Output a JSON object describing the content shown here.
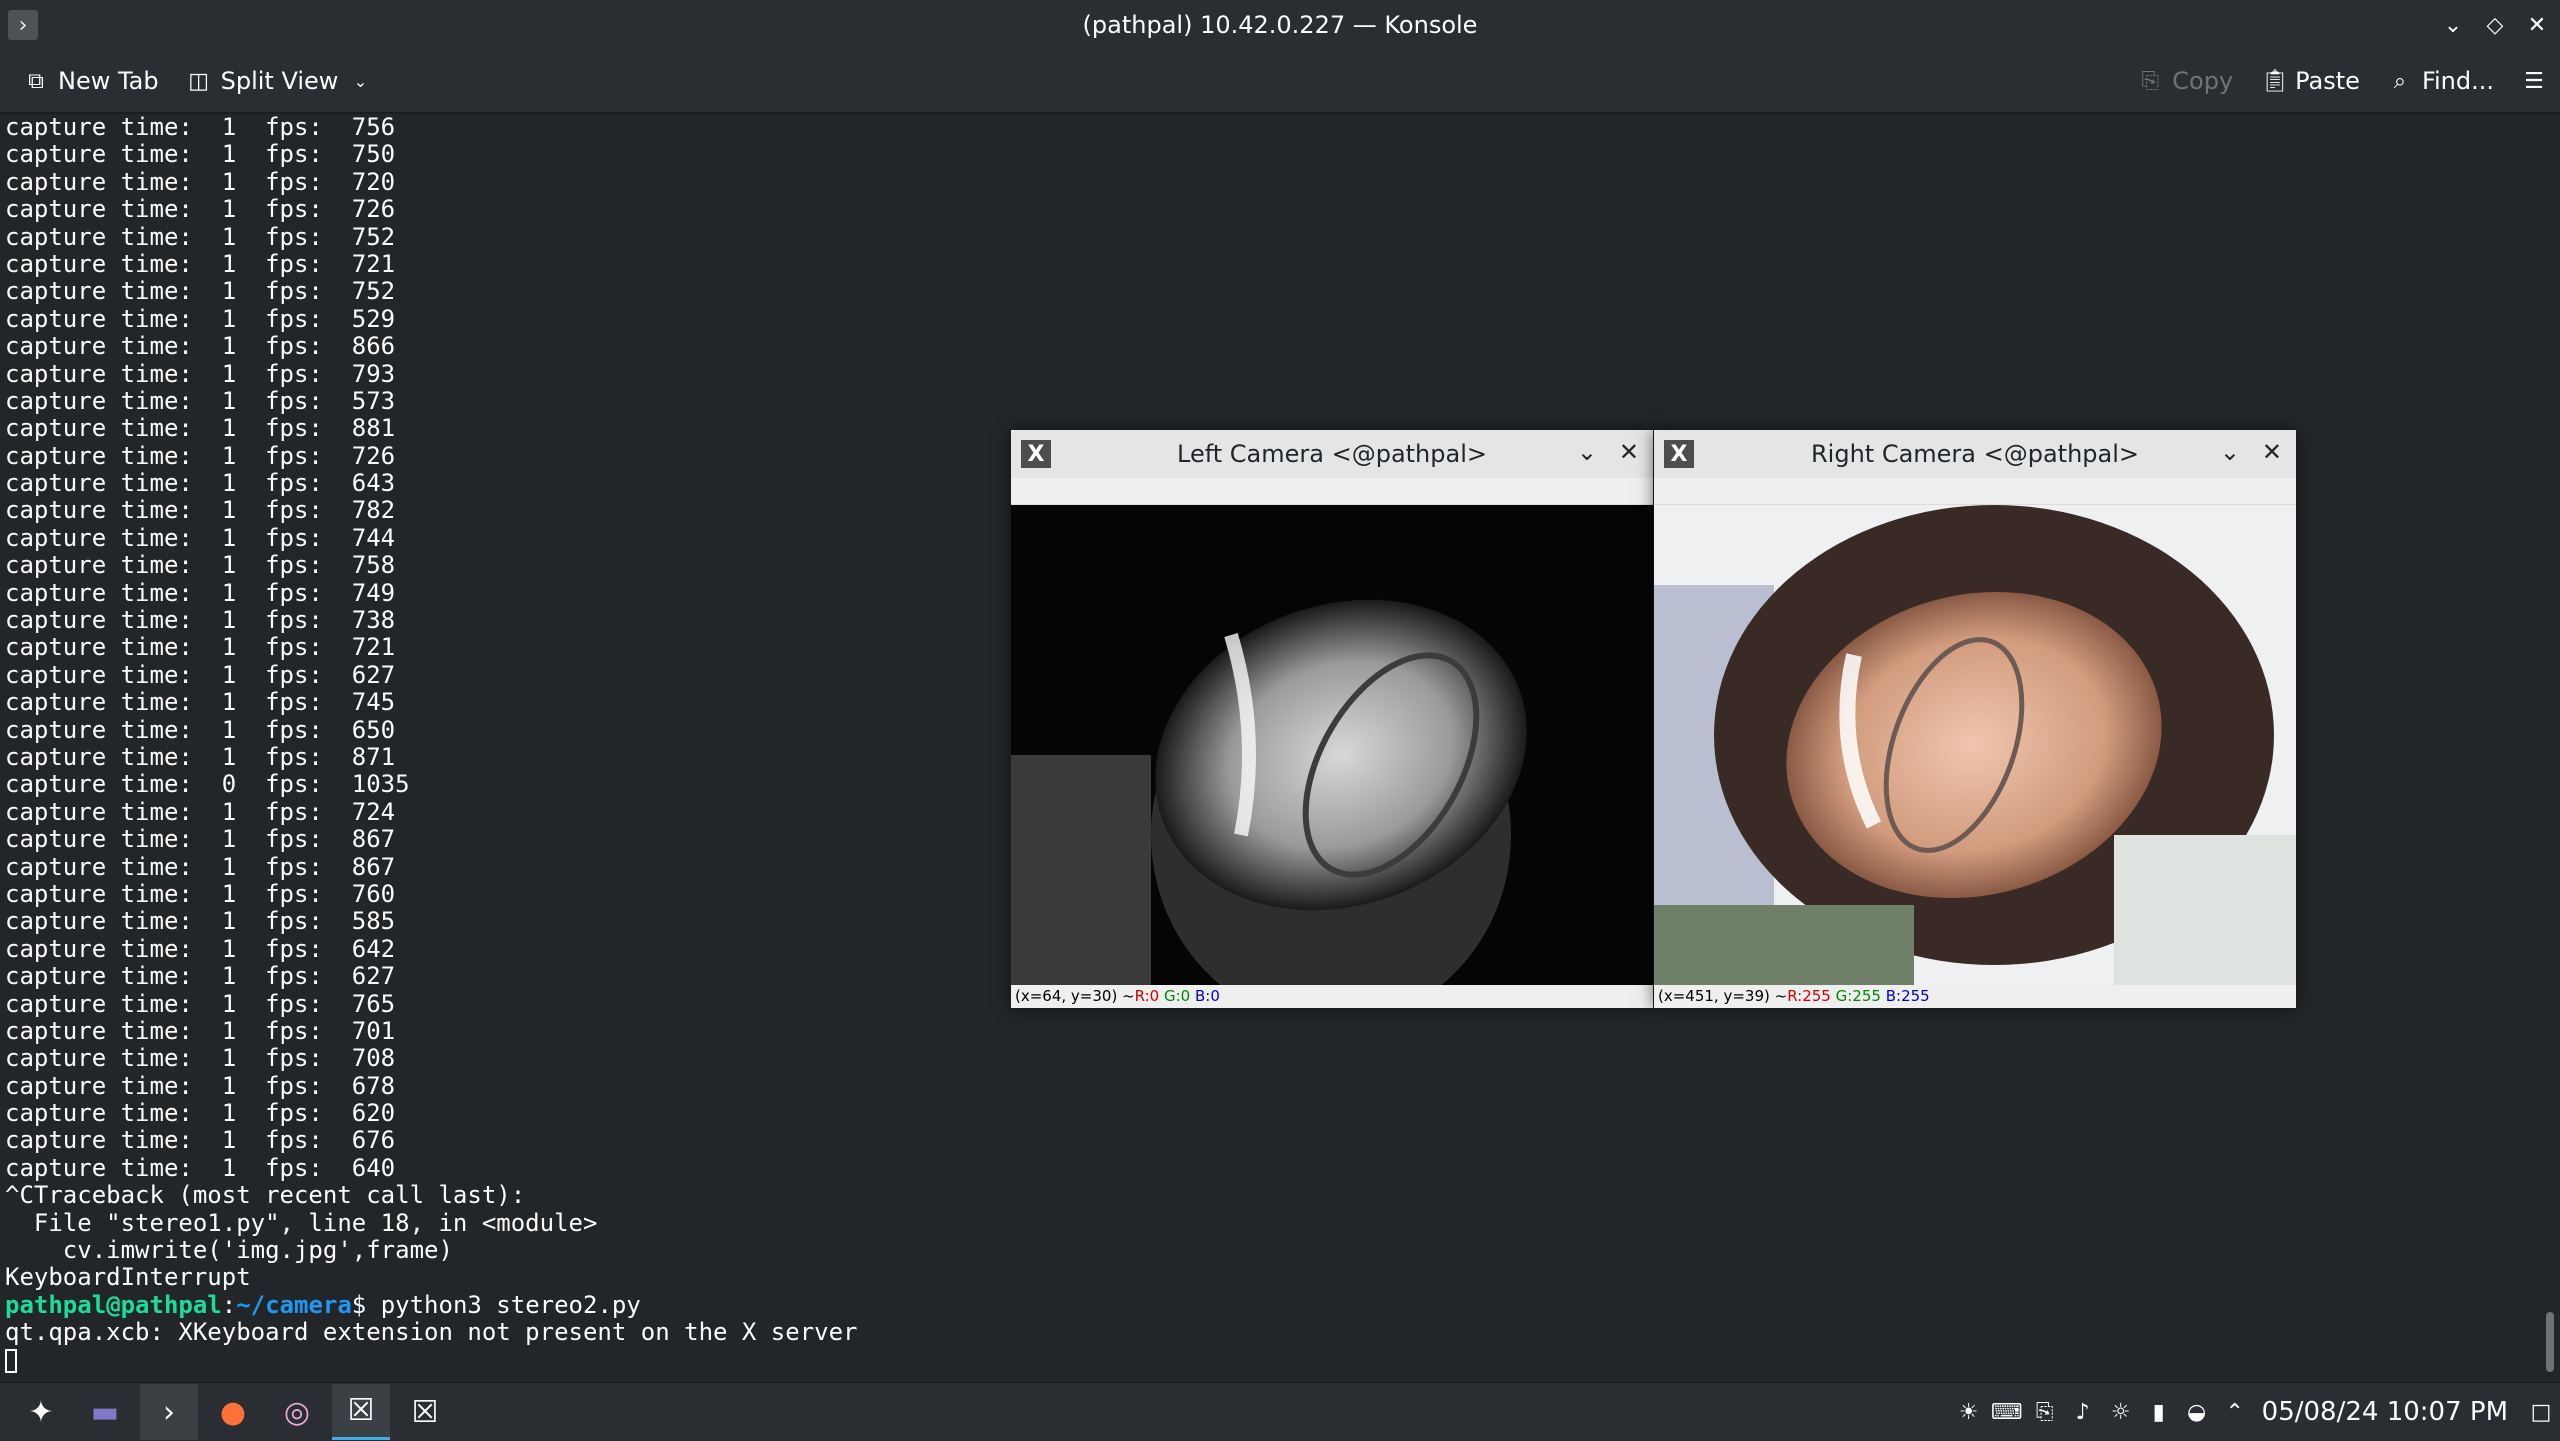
{
  "window": {
    "title": "(pathpal) 10.42.0.227 — Konsole"
  },
  "toolbar": {
    "new_tab": "New Tab",
    "split_view": "Split View",
    "copy": "Copy",
    "paste": "Paste",
    "find": "Find..."
  },
  "terminal": {
    "lines": [
      "capture time:  1  fps:  756",
      "capture time:  1  fps:  750",
      "capture time:  1  fps:  720",
      "capture time:  1  fps:  726",
      "capture time:  1  fps:  752",
      "capture time:  1  fps:  721",
      "capture time:  1  fps:  752",
      "capture time:  1  fps:  529",
      "capture time:  1  fps:  866",
      "capture time:  1  fps:  793",
      "capture time:  1  fps:  573",
      "capture time:  1  fps:  881",
      "capture time:  1  fps:  726",
      "capture time:  1  fps:  643",
      "capture time:  1  fps:  782",
      "capture time:  1  fps:  744",
      "capture time:  1  fps:  758",
      "capture time:  1  fps:  749",
      "capture time:  1  fps:  738",
      "capture time:  1  fps:  721",
      "capture time:  1  fps:  627",
      "capture time:  1  fps:  745",
      "capture time:  1  fps:  650",
      "capture time:  1  fps:  871",
      "capture time:  0  fps:  1035",
      "capture time:  1  fps:  724",
      "capture time:  1  fps:  867",
      "capture time:  1  fps:  867",
      "capture time:  1  fps:  760",
      "capture time:  1  fps:  585",
      "capture time:  1  fps:  642",
      "capture time:  1  fps:  627",
      "capture time:  1  fps:  765",
      "capture time:  1  fps:  701",
      "capture time:  1  fps:  708",
      "capture time:  1  fps:  678",
      "capture time:  1  fps:  620",
      "capture time:  1  fps:  676",
      "capture time:  1  fps:  640",
      "^CTraceback (most recent call last):",
      "  File \"stereo1.py\", line 18, in <module>",
      "    cv.imwrite('img.jpg',frame)",
      "KeyboardInterrupt"
    ],
    "prompt_user": "pathpal@pathpal",
    "prompt_sep": ":",
    "prompt_dir": "~/camera",
    "prompt_end": "$ ",
    "command": "python3 stereo2.py",
    "output": "qt.qpa.xcb: XKeyboard extension not present on the X server"
  },
  "left_camera": {
    "title": "Left Camera <@pathpal>",
    "coords": "(x=64, y=30) ~ ",
    "r": "R:0",
    "g": "G:0",
    "b": "B:0"
  },
  "right_camera": {
    "title": "Right Camera <@pathpal>",
    "coords": "(x=451, y=39) ~ ",
    "r": "R:255",
    "g": "G:255",
    "b": "B:255"
  },
  "taskbar": {
    "clock": "05/08/24 10:07 PM"
  },
  "colors": {
    "bg": "#232629",
    "prompt_user": "#1cdc9a",
    "prompt_dir": "#1d99f3",
    "accent": "#3daee9"
  }
}
